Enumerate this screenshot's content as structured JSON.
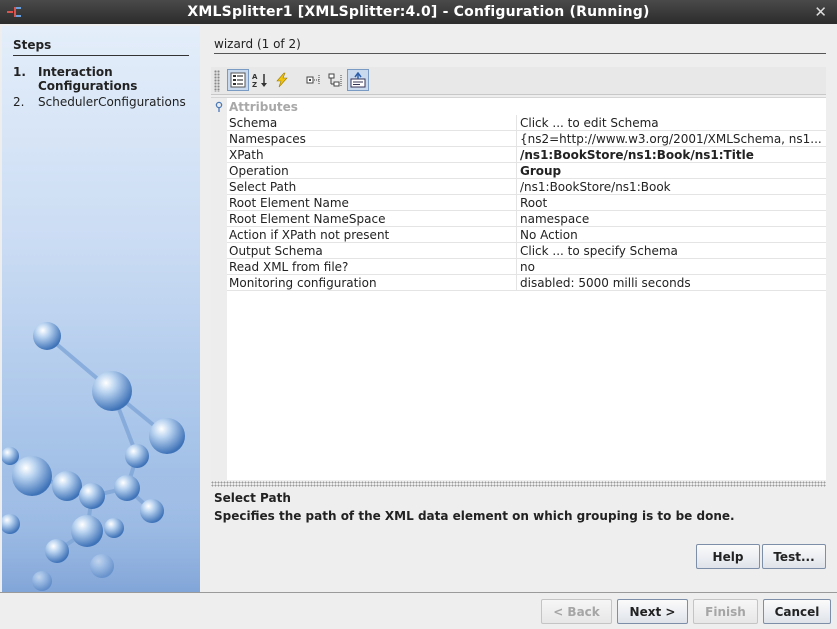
{
  "window": {
    "title": "XMLSplitter1 [XMLSplitter:4.0] - Configuration (Running)",
    "close_glyph": "✕"
  },
  "steps": {
    "heading": "Steps",
    "items": [
      {
        "number": "1.",
        "label": "Interaction Configurations",
        "active": true
      },
      {
        "number": "2.",
        "label": "SchedulerConfigurations",
        "active": false
      }
    ]
  },
  "wizard": {
    "heading": "wizard (1 of 2)"
  },
  "toolbar": {
    "buttons": [
      {
        "name": "categorized-view-icon",
        "pressed": true
      },
      {
        "name": "sort-alphabetically-icon",
        "pressed": false
      },
      {
        "name": "lightning-icon",
        "pressed": false
      },
      {
        "name": "show-editable-icon",
        "pressed": false
      },
      {
        "name": "show-tree-icon",
        "pressed": false
      },
      {
        "name": "description-panel-icon",
        "pressed": true
      }
    ]
  },
  "properties": {
    "category": "Attributes",
    "rows": [
      {
        "name": "Schema",
        "value": "Click ... to edit Schema",
        "bold": false
      },
      {
        "name": "Namespaces",
        "value": "{ns2=http://www.w3.org/2001/XMLSchema, ns1...",
        "bold": false
      },
      {
        "name": "XPath",
        "value": "/ns1:BookStore/ns1:Book/ns1:Title",
        "bold": true
      },
      {
        "name": "Operation",
        "value": "Group",
        "bold": true
      },
      {
        "name": "Select Path",
        "value": "/ns1:BookStore/ns1:Book",
        "bold": false
      },
      {
        "name": "Root Element Name",
        "value": "Root",
        "bold": false
      },
      {
        "name": "Root Element NameSpace",
        "value": "namespace",
        "bold": false
      },
      {
        "name": "Action if XPath not present",
        "value": "No Action",
        "bold": false
      },
      {
        "name": "Output Schema",
        "value": "Click ... to specify Schema",
        "bold": false
      },
      {
        "name": "Read XML from file?",
        "value": "no",
        "bold": false
      },
      {
        "name": "Monitoring configuration",
        "value": "disabled: 5000 milli seconds",
        "bold": false
      }
    ]
  },
  "description": {
    "title": "Select Path",
    "text": "Specifies the path of the XML data element on which grouping is to be done."
  },
  "buttons": {
    "help": "Help",
    "test": "Test...",
    "back": "< Back",
    "next": "Next >",
    "finish": "Finish",
    "cancel": "Cancel"
  },
  "colors": {
    "titlebar": "#2b2b2b",
    "steps_panel": "#aac6ea",
    "disabled_text": "#a5a5a5",
    "category_text": "#a8a8a8"
  }
}
